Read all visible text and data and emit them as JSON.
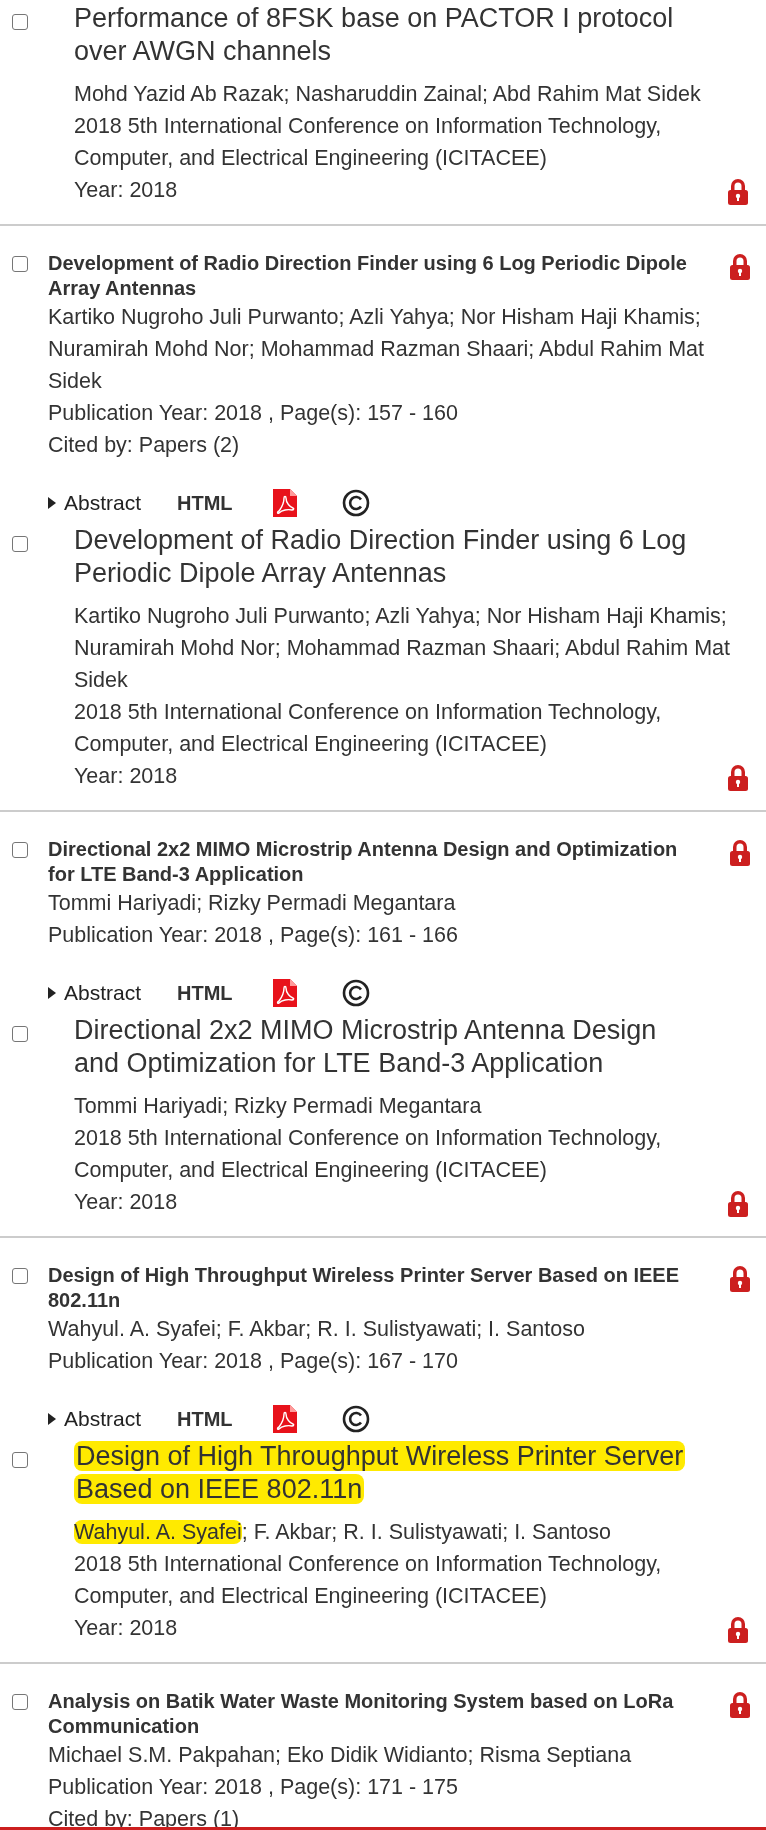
{
  "items": [
    {
      "kind": "citation",
      "selected": false,
      "title": "Performance of 8FSK base on PACTOR I protocol over AWGN channels",
      "title_highlighted": false,
      "authors": [
        {
          "text": "Mohd Yazid Ab Razak; Nasharuddin Zainal; Abd Rahim Mat Sidek",
          "highlighted": false
        }
      ],
      "venue": "2018 5th International Conference on Information Technology, Computer, and Electrical Engineering (ICITACEE)",
      "year": "Year: 2018"
    },
    {
      "kind": "result",
      "selected": false,
      "title": "Development of Radio Direction Finder using 6 Log Periodic Dipole Array Antennas",
      "authors": "Kartiko Nugroho Juli Purwanto; Azli Yahya; Nor Hisham Haji Khamis; Nuramirah Mohd Nor; Mohammad Razman Shaari; Abdul Rahim Mat Sidek",
      "pub": "Publication Year: 2018 , Page(s): 157  -  160",
      "cited": "Cited by: Papers (2)",
      "abstract": "Abstract",
      "html": "HTML"
    },
    {
      "kind": "citation",
      "selected": false,
      "title": "Development of Radio Direction Finder using 6 Log Periodic Dipole Array Antennas",
      "title_highlighted": false,
      "authors": [
        {
          "text": "Kartiko Nugroho Juli Purwanto; Azli Yahya; Nor Hisham Haji Khamis; Nuramirah Mohd Nor; Mohammad Razman Shaari; Abdul Rahim Mat Sidek",
          "highlighted": false
        }
      ],
      "venue": "2018 5th International Conference on Information Technology, Computer, and Electrical Engineering (ICITACEE)",
      "year": "Year: 2018"
    },
    {
      "kind": "result",
      "selected": false,
      "title": "Directional 2x2 MIMO Microstrip Antenna Design and Optimization for LTE Band-3 Application",
      "authors": "Tommi Hariyadi; Rizky Permadi Megantara",
      "pub": "Publication Year: 2018 , Page(s): 161  -  166",
      "abstract": "Abstract",
      "html": "HTML"
    },
    {
      "kind": "citation",
      "selected": false,
      "title": "Directional 2x2 MIMO Microstrip Antenna Design and Optimization for LTE Band-3 Application",
      "title_highlighted": false,
      "authors": [
        {
          "text": "Tommi Hariyadi; Rizky Permadi Megantara",
          "highlighted": false
        }
      ],
      "venue": "2018 5th International Conference on Information Technology, Computer, and Electrical Engineering (ICITACEE)",
      "year": "Year: 2018"
    },
    {
      "kind": "result",
      "selected": false,
      "title": "Design of High Throughput Wireless Printer Server Based on IEEE 802.11n",
      "authors": "Wahyul. A. Syafei; F. Akbar; R. I. Sulistyawati; I. Santoso",
      "pub": "Publication Year: 2018 , Page(s): 167  -  170",
      "abstract": "Abstract",
      "html": "HTML"
    },
    {
      "kind": "citation",
      "selected": false,
      "title": "Design of High Throughput Wireless Printer Server Based on IEEE 802.11n",
      "title_highlighted": true,
      "authors": [
        {
          "text": "Wahyul. A. Syafei",
          "highlighted": true
        },
        {
          "text": "; F. Akbar; R. I. Sulistyawati; I. Santoso",
          "highlighted": false
        }
      ],
      "venue": "2018 5th International Conference on Information Technology, Computer, and Electrical Engineering (ICITACEE)",
      "year": "Year: 2018"
    },
    {
      "kind": "result",
      "selected": false,
      "title": "Analysis on Batik Water Waste Monitoring System based on LoRa Communication",
      "authors": "Michael S.M. Pakpahan; Eko Didik Widianto; Risma Septiana",
      "pub": "Publication Year: 2018 , Page(s): 171  -  175",
      "cited": "Cited by: Papers (1)"
    }
  ]
}
